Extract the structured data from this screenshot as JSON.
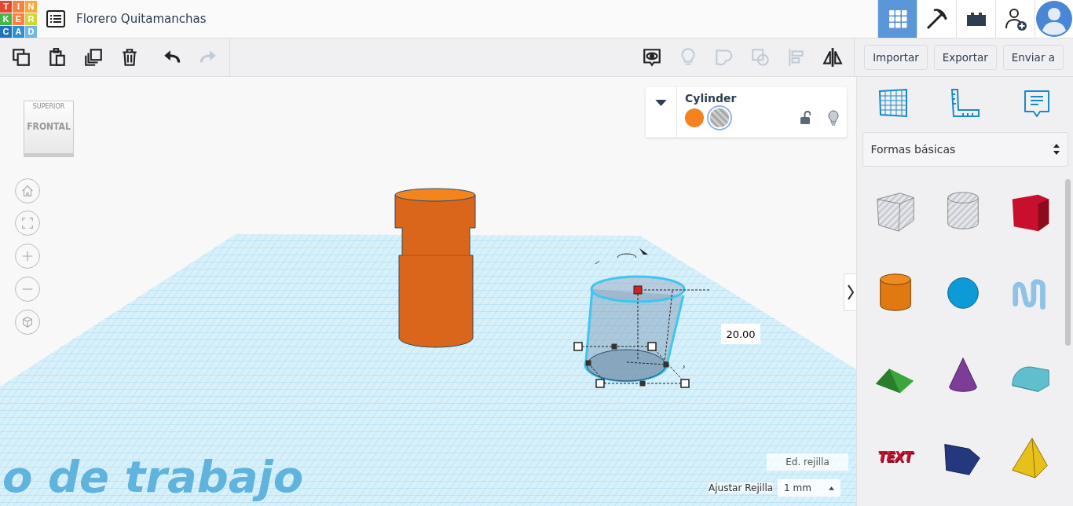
{
  "logo": {
    "letters": [
      {
        "text": "T",
        "color": "#e4472f"
      },
      {
        "text": "I",
        "color": "#f7823b"
      },
      {
        "text": "N",
        "color": "#f7a93b"
      },
      {
        "text": "K",
        "color": "#48b44a"
      },
      {
        "text": "E",
        "color": "#f7823b"
      },
      {
        "text": "R",
        "color": "#cfd734"
      },
      {
        "text": "C",
        "color": "#1d76bb"
      },
      {
        "text": "A",
        "color": "#2d8fd5"
      },
      {
        "text": "D",
        "color": "#6fb8e6"
      }
    ]
  },
  "project_title": "Florero Quitamanchas",
  "header_buttons": [
    {
      "kind": "grid",
      "selected": true
    },
    {
      "kind": "pickaxe",
      "selected": false
    },
    {
      "kind": "bricks",
      "selected": false
    },
    {
      "kind": "add-user",
      "selected": false
    }
  ],
  "toolbar_left": [
    {
      "kind": "copy",
      "disabled": false
    },
    {
      "kind": "paste",
      "disabled": false
    },
    {
      "kind": "duplicate",
      "disabled": false
    },
    {
      "kind": "delete",
      "disabled": false
    },
    {
      "kind": "undo",
      "disabled": false
    },
    {
      "kind": "redo",
      "disabled": true
    }
  ],
  "toolbar_right": [
    {
      "kind": "notes",
      "disabled": false
    },
    {
      "kind": "light",
      "disabled": true
    },
    {
      "kind": "group",
      "disabled": true
    },
    {
      "kind": "ungroup",
      "disabled": true
    },
    {
      "kind": "align",
      "disabled": true
    },
    {
      "kind": "mirror",
      "disabled": false
    }
  ],
  "actions": [
    "Importar",
    "Exportar",
    "Enviar a"
  ],
  "view_cube": {
    "top": "SUPERIOR",
    "front": "FRONTAL"
  },
  "nav_buttons": [
    {
      "kind": "home"
    },
    {
      "kind": "fit"
    },
    {
      "kind": "zoom-in"
    },
    {
      "kind": "zoom-out"
    },
    {
      "kind": "perspective"
    }
  ],
  "shape_panel": {
    "title": "Cylinder",
    "locked": false,
    "chips": [
      {
        "kind": "solid",
        "color": "#f5821f",
        "selected": false
      },
      {
        "kind": "hole",
        "selected": true
      }
    ]
  },
  "workplane": {
    "watermark": "o de trabajo",
    "dimension": "20.00",
    "edit_grid": "Ed. rejilla",
    "snap_label": "Ajustar Rejilla",
    "snap_value": "1 mm"
  },
  "library": {
    "tabs": [
      {
        "kind": "workplane"
      },
      {
        "kind": "ruler"
      },
      {
        "kind": "notes"
      }
    ],
    "category": "Formas básicas",
    "shapes": [
      {
        "kind": "hole-box"
      },
      {
        "kind": "hole-cylinder"
      },
      {
        "kind": "box",
        "color": "#c8102e"
      },
      {
        "kind": "cylinder",
        "color": "#e07a10"
      },
      {
        "kind": "sphere",
        "color": "#0d9bd8"
      },
      {
        "kind": "scribble",
        "color": "#8fc3e6"
      },
      {
        "kind": "roof",
        "color": "#3aa63c"
      },
      {
        "kind": "cone",
        "color": "#7d3c98"
      },
      {
        "kind": "round-roof",
        "color": "#5fbfcc"
      },
      {
        "kind": "text",
        "color": "#c8102e",
        "label": "TEXT"
      },
      {
        "kind": "wedge",
        "color": "#24397d"
      },
      {
        "kind": "pyramid",
        "color": "#e8c01a"
      }
    ]
  }
}
